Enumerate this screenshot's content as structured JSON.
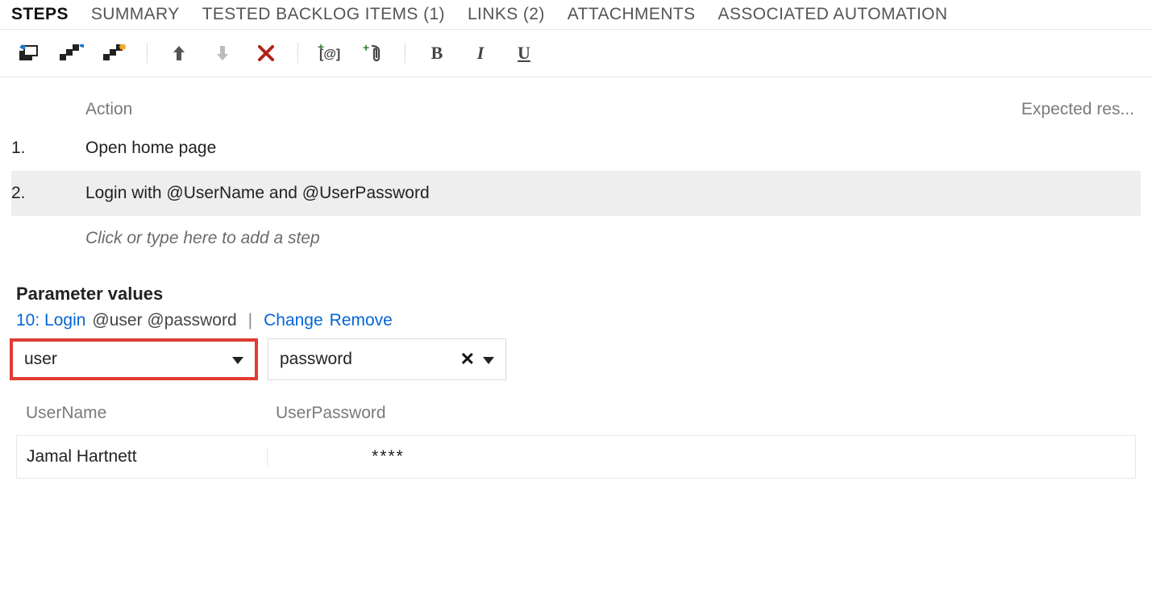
{
  "tabs": {
    "steps": "STEPS",
    "summary": "SUMMARY",
    "tbi": "TESTED BACKLOG ITEMS (1)",
    "links": "LINKS (2)",
    "attachments": "ATTACHMENTS",
    "automation": "ASSOCIATED AUTOMATION"
  },
  "columns": {
    "action": "Action",
    "expected": "Expected res..."
  },
  "steps": {
    "r1": {
      "num": "1.",
      "action": "Open home page"
    },
    "r2": {
      "num": "2.",
      "action": "Login with  @UserName and  @UserPassword"
    },
    "placeholder": "Click or type here to add a step"
  },
  "params": {
    "title": "Parameter values",
    "link_id": "10: Login",
    "link_args": "@user @password",
    "change": "Change",
    "remove": "Remove",
    "sel_user": "user",
    "sel_pass": "password",
    "head_user": "UserName",
    "head_pass": "UserPassword",
    "val_user": "Jamal Hartnett",
    "val_pass": "****"
  }
}
